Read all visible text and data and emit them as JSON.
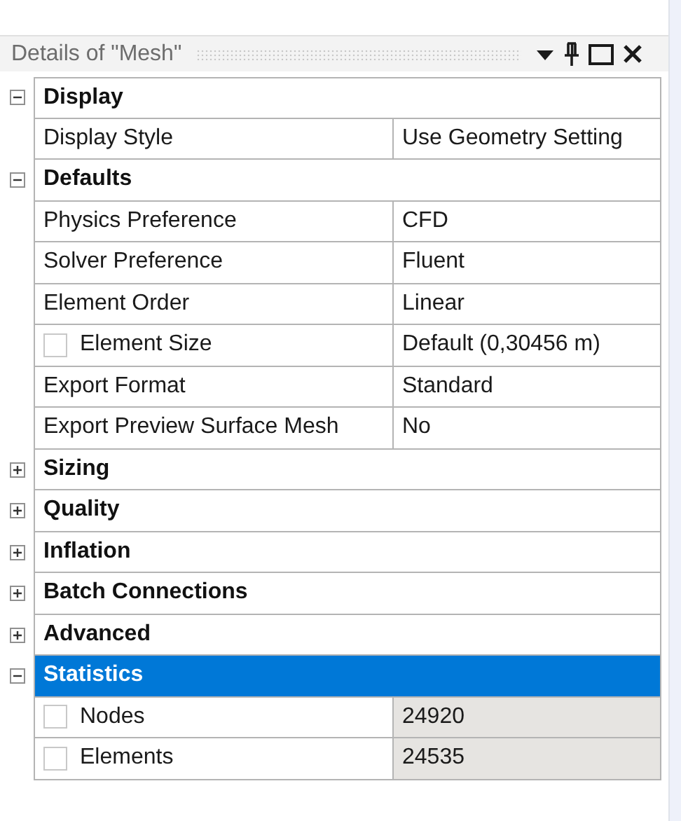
{
  "panel": {
    "title": "Details of \"Mesh\""
  },
  "groups": [
    {
      "name": "Display",
      "expanded": true,
      "selected": false,
      "properties": [
        {
          "kind": "plain",
          "label": "Display Style",
          "value": "Use Geometry Setting",
          "readonly": false
        }
      ]
    },
    {
      "name": "Defaults",
      "expanded": true,
      "selected": false,
      "properties": [
        {
          "kind": "plain",
          "label": "Physics Preference",
          "value": "CFD",
          "readonly": false
        },
        {
          "kind": "plain",
          "label": "Solver Preference",
          "value": "Fluent",
          "readonly": false
        },
        {
          "kind": "plain",
          "label": "Element Order",
          "value": "Linear",
          "readonly": false
        },
        {
          "kind": "checkbox",
          "checked": false,
          "label": "Element Size",
          "value": "Default (0,30456 m)",
          "readonly": false
        },
        {
          "kind": "plain",
          "label": "Export Format",
          "value": "Standard",
          "readonly": false
        },
        {
          "kind": "plain",
          "label": "Export Preview Surface Mesh",
          "value": "No",
          "readonly": false
        }
      ]
    },
    {
      "name": "Sizing",
      "expanded": false,
      "selected": false
    },
    {
      "name": "Quality",
      "expanded": false,
      "selected": false
    },
    {
      "name": "Inflation",
      "expanded": false,
      "selected": false
    },
    {
      "name": "Batch Connections",
      "expanded": false,
      "selected": false
    },
    {
      "name": "Advanced",
      "expanded": false,
      "selected": false
    },
    {
      "name": "Statistics",
      "expanded": true,
      "selected": true,
      "properties": [
        {
          "kind": "checkbox",
          "checked": false,
          "label": "Nodes",
          "value": "24920",
          "readonly": true
        },
        {
          "kind": "checkbox",
          "checked": false,
          "label": "Elements",
          "value": "24535",
          "readonly": true
        }
      ]
    }
  ]
}
